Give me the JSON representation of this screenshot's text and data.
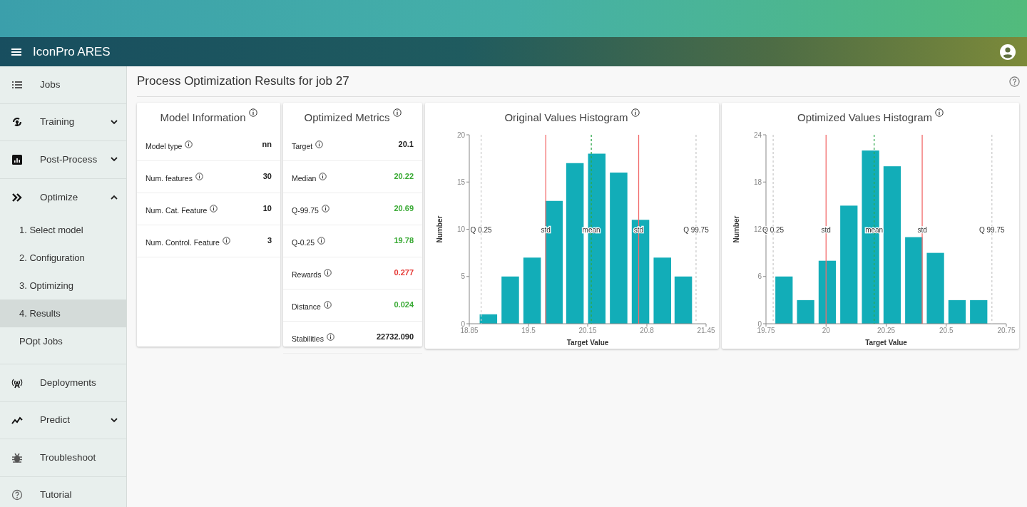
{
  "app": {
    "title": "IconPro ARES"
  },
  "sidebar": {
    "items": [
      {
        "kind": "link",
        "label": "Jobs"
      },
      {
        "kind": "group",
        "label": "Training",
        "expanded": false
      },
      {
        "kind": "group",
        "label": "Post-Process",
        "expanded": false
      },
      {
        "kind": "group",
        "label": "Optimize",
        "expanded": true,
        "children": [
          {
            "label": "1. Select model",
            "selected": false
          },
          {
            "label": "2. Configuration",
            "selected": false
          },
          {
            "label": "3. Optimizing",
            "selected": false
          },
          {
            "label": "4. Results",
            "selected": true
          },
          {
            "label": "POpt Jobs",
            "selected": false
          }
        ]
      },
      {
        "kind": "link",
        "label": "Deployments"
      },
      {
        "kind": "group",
        "label": "Predict",
        "expanded": false
      },
      {
        "kind": "link",
        "label": "Troubleshoot"
      },
      {
        "kind": "link",
        "label": "Tutorial"
      }
    ]
  },
  "page": {
    "title": "Process Optimization Results for job 27"
  },
  "model_information": {
    "title": "Model Information",
    "rows": [
      {
        "label": "Model type",
        "value": "nn"
      },
      {
        "label": "Num. features",
        "value": "30"
      },
      {
        "label": "Num. Cat. Feature",
        "value": "10"
      },
      {
        "label": "Num. Control. Feature",
        "value": "3"
      }
    ]
  },
  "optimized_metrics": {
    "title": "Optimized Metrics",
    "rows": [
      {
        "label": "Target",
        "value": "20.1",
        "color": "#222222"
      },
      {
        "label": "Median",
        "value": "20.22",
        "color": "#3aaa35"
      },
      {
        "label": "Q-99.75",
        "value": "20.69",
        "color": "#3aaa35"
      },
      {
        "label": "Q-0.25",
        "value": "19.78",
        "color": "#3aaa35"
      },
      {
        "label": "Rewards",
        "value": "0.277",
        "color": "#e53935"
      },
      {
        "label": "Distance",
        "value": "0.024",
        "color": "#3aaa35"
      },
      {
        "label": "Stabilities",
        "value": "22732.090",
        "color": "#222222"
      }
    ]
  },
  "histograms": [
    {
      "chart_data": {
        "type": "bar",
        "title": "Original Values Histogram",
        "xlabel": "Target Value",
        "ylabel": "Number",
        "x": [
          19.06,
          19.3,
          19.54,
          19.78,
          20.01,
          20.25,
          20.49,
          20.73,
          20.97,
          21.2
        ],
        "series": [
          {
            "color": "#12adb8",
            "values": [
              1,
              5,
              7,
              13,
              17,
              18,
              16,
              11,
              7,
              5
            ]
          }
        ],
        "xlim": [
          18.85,
          21.45
        ],
        "ylim": [
          0,
          20
        ],
        "xticks": [
          18.85,
          19.5,
          20.15,
          20.8,
          21.45
        ],
        "yticks": [
          0,
          5,
          10,
          15,
          20
        ],
        "ref_lines": [
          {
            "axis": "x",
            "value": 18.98,
            "label": "Q 0.25",
            "color": "#cccccc"
          },
          {
            "axis": "x",
            "value": 19.69,
            "label": "std",
            "color": "#f26b6b"
          },
          {
            "axis": "x",
            "value": 20.19,
            "label": "mean",
            "color": "#2ea84a"
          },
          {
            "axis": "x",
            "value": 20.71,
            "label": "std",
            "color": "#f26b6b"
          },
          {
            "axis": "x",
            "value": 21.34,
            "label": "Q 99.75",
            "color": "#cccccc"
          }
        ]
      }
    },
    {
      "chart_data": {
        "type": "bar",
        "title": "Optimized Values Histogram",
        "xlabel": "Target Value",
        "ylabel": "Number",
        "x": [
          19.825,
          19.915,
          20.005,
          20.095,
          20.185,
          20.275,
          20.365,
          20.455,
          20.545,
          20.635
        ],
        "series": [
          {
            "color": "#12adb8",
            "values": [
              6,
              3,
              8,
              15,
              22,
              20,
              11,
              9,
              3,
              3
            ]
          }
        ],
        "xlim": [
          19.75,
          20.75
        ],
        "ylim": [
          0,
          24
        ],
        "xticks": [
          19.75,
          20,
          20.25,
          20.5,
          20.75
        ],
        "yticks": [
          0,
          6,
          12,
          18,
          24
        ],
        "ref_lines": [
          {
            "axis": "x",
            "value": 19.78,
            "label": "Q 0.25",
            "color": "#cccccc"
          },
          {
            "axis": "x",
            "value": 20.0,
            "label": "std",
            "color": "#f26b6b"
          },
          {
            "axis": "x",
            "value": 20.2,
            "label": "mean",
            "color": "#2ea84a"
          },
          {
            "axis": "x",
            "value": 20.4,
            "label": "std",
            "color": "#f26b6b"
          },
          {
            "axis": "x",
            "value": 20.69,
            "label": "Q 99.75",
            "color": "#cccccc"
          }
        ]
      }
    }
  ]
}
